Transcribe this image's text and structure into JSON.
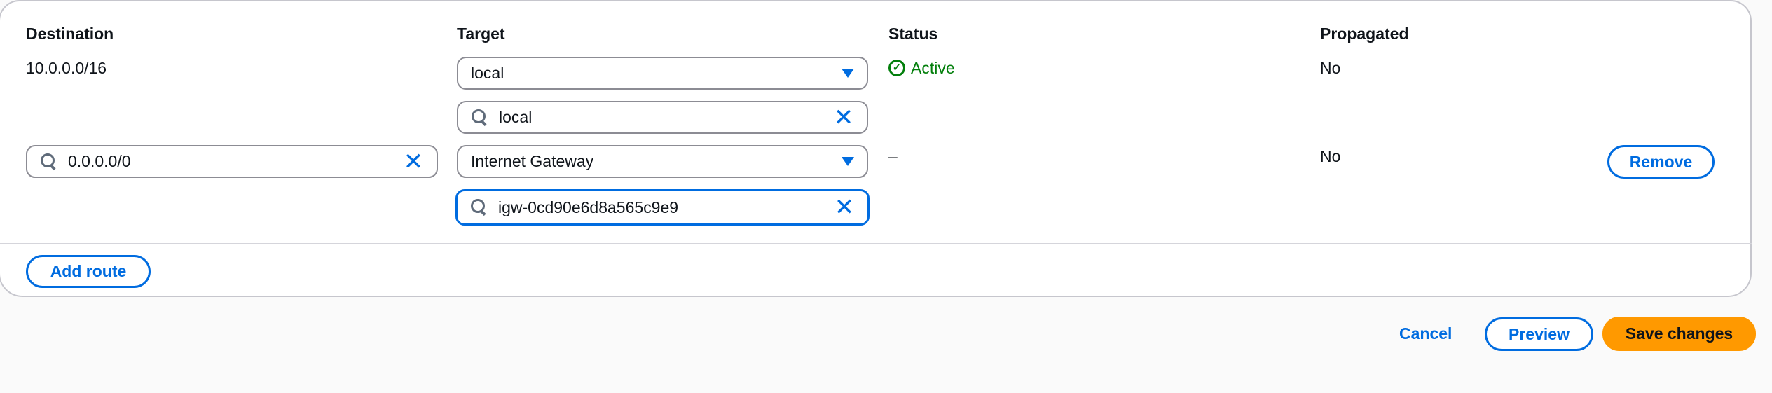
{
  "table": {
    "headers": {
      "destination": "Destination",
      "target": "Target",
      "status": "Status",
      "propagated": "Propagated"
    },
    "rows": [
      {
        "destination": "10.0.0.0/16",
        "target_type": "local",
        "target_value": "local",
        "status": "Active",
        "propagated": "No"
      },
      {
        "destination": "0.0.0.0/0",
        "target_type": "Internet Gateway",
        "target_value": "igw-0cd90e6d8a565c9e9",
        "status": "–",
        "propagated": "No",
        "remove_label": "Remove"
      }
    ]
  },
  "add_route_label": "Add route",
  "footer": {
    "cancel": "Cancel",
    "preview": "Preview",
    "save": "Save changes"
  },
  "colors": {
    "accent": "#006ce0",
    "success": "#037f0c",
    "primary": "#ff9900"
  }
}
